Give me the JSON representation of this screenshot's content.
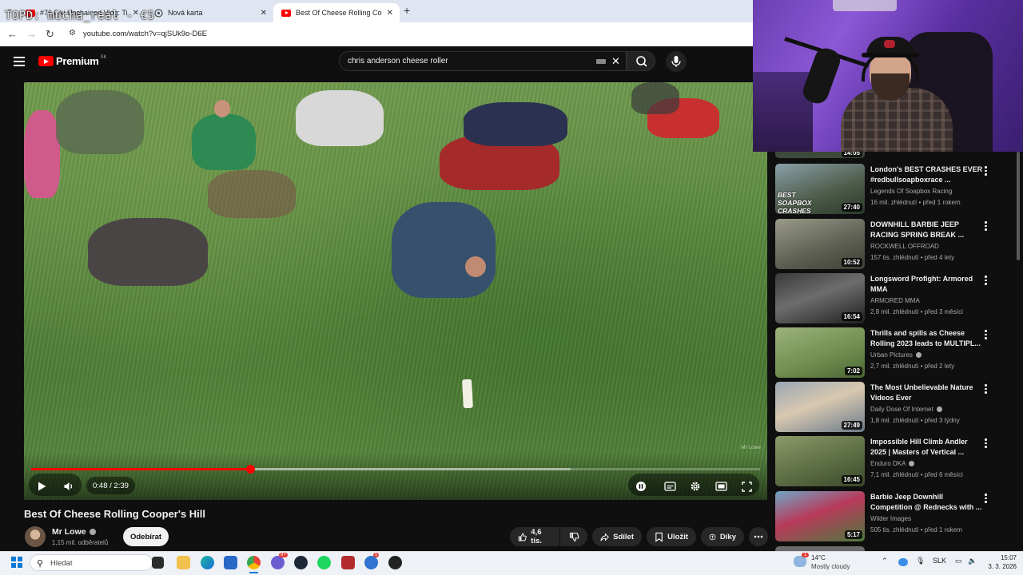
{
  "overlay_text": "TOPD: mucha_real - €5",
  "browser": {
    "tabs": [
      {
        "title": "#76 Fiki Unchained Vlog: Tieto"
      },
      {
        "title": "Nová karta"
      },
      {
        "title": "Best Of Cheese Rolling Cooper's"
      }
    ],
    "new_tab_label": "+",
    "url": "youtube.com/watch?v=qjSUk9o-D6E"
  },
  "youtube": {
    "logo_text": "Premium",
    "country_code": "SK",
    "search_query": "chris anderson cheese roller",
    "player": {
      "current_time": "0:48",
      "separator": " / ",
      "duration": "2:39",
      "progress_fraction": 0.3,
      "buffered_fraction": 0.74,
      "watermark": "Mr Lowe"
    },
    "video": {
      "title": "Best Of Cheese Rolling Cooper's Hill",
      "channel": "Mr Lowe",
      "subscribers": "1,15 mil. odběratelů",
      "subscribe_label": "Odebírat",
      "likes": "4,6 tis.",
      "share_label": "Sdílet",
      "save_label": "Uložit",
      "thanks_label": "Díky"
    },
    "top_partial_duration": "14:05",
    "recommendations": [
      {
        "title": "London's BEST CRASHES EVER #redbullsoapboxrace ...",
        "channel": "Legends Of Soapbox Racing",
        "meta": "16 mil. zhlédnutí • před 1 rokem",
        "duration": "27:40",
        "thumb_text": "BEST SOAPBOX CRASHES",
        "verified": false
      },
      {
        "title": "DOWNHILL BARBIE JEEP RACING SPRING BREAK ...",
        "channel": "ROCKWELL OFFROAD",
        "meta": "157 tis. zhlédnutí • před 4 lety",
        "duration": "10:52",
        "thumb_text": "",
        "verified": false
      },
      {
        "title": "Longsword Profight: Armored MMA",
        "channel": "ARMORED MMA",
        "meta": "2,8 mil. zhlédnutí • před 3 měsíci",
        "duration": "16:54",
        "thumb_text": "",
        "verified": false
      },
      {
        "title": "Thrills and spills as Cheese Rolling 2023 leads to MULTIPL...",
        "channel": "Urban Pictures",
        "meta": "2,7 mil. zhlédnutí • před 2 lety",
        "duration": "7:02",
        "thumb_text": "",
        "verified": true
      },
      {
        "title": "The Most Unbelievable Nature Videos Ever",
        "channel": "Daily Dose Of Internet",
        "meta": "1,8 mil. zhlédnutí • před 3 týdny",
        "duration": "27:49",
        "thumb_text": "",
        "verified": true
      },
      {
        "title": "Impossible Hill Climb Andler 2025 | Masters of Vertical ...",
        "channel": "Enduro DKA",
        "meta": "7,1 mil. zhlédnutí • před 6 měsíci",
        "duration": "16:45",
        "thumb_text": "",
        "verified": true
      },
      {
        "title": "Barbie Jeep Downhill Competition @ Rednecks with ...",
        "channel": "Wilder Images",
        "meta": "505 tis. zhlédnutí • před 1 rokem",
        "duration": "5:17",
        "thumb_text": "",
        "verified": false
      }
    ]
  },
  "taskbar": {
    "search_placeholder": "Hledat",
    "weather_temp": "14°C",
    "weather_status": "Mostly cloudy",
    "language": "SLK",
    "time": "15:07",
    "date": "3. 3. 2026",
    "weather_badge": "1",
    "discord_badge": "9+",
    "mail_badge": "5"
  },
  "colors": {
    "accent": "#ff0000",
    "page_bg": "#0f0f0f",
    "taskbar_bg": "#eef1f6",
    "win_blue": "#0a78d4"
  }
}
